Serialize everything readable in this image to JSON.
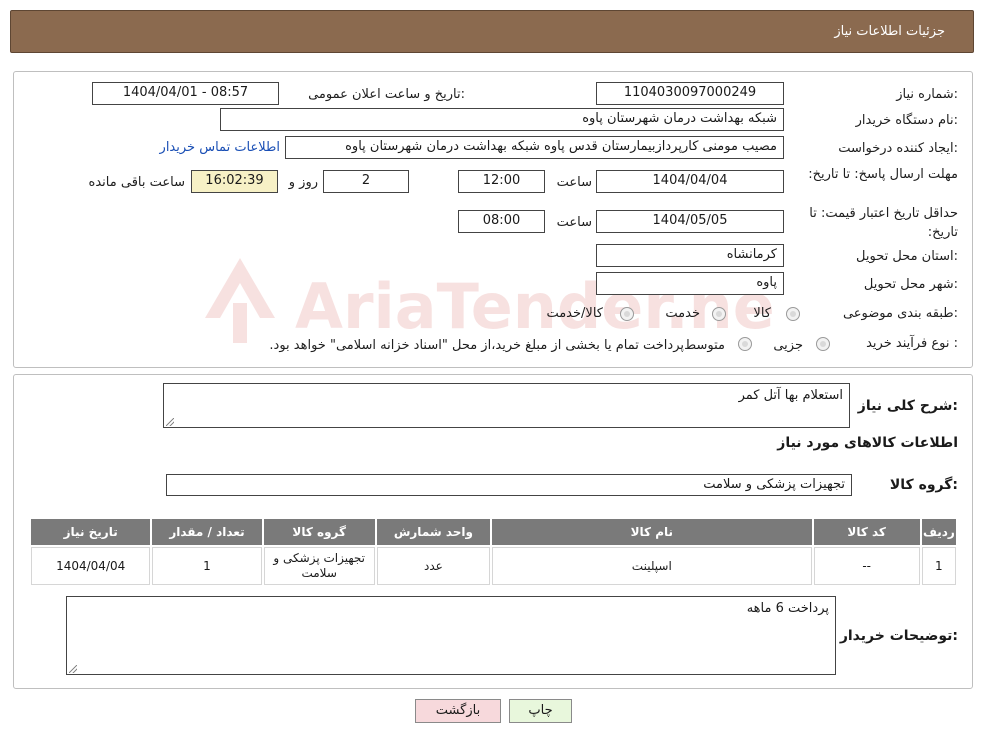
{
  "header": {
    "title": "جزئیات اطلاعات نیاز"
  },
  "watermark": {
    "text": "AriaTender.neT"
  },
  "form": {
    "need_number_label": "شماره نیاز:",
    "need_number": "1104030097000249",
    "announce_label": "تاریخ و ساعت اعلان عمومی:",
    "announce_value": "1404/04/01 - 08:57",
    "buyer_label": "نام دستگاه خریدار:",
    "buyer_value": "شبکه بهداشت درمان شهرستان پاوه",
    "creator_label": "ایجاد کننده درخواست:",
    "creator_value": "مصیب مومنی کارپردازبیمارستان قدس پاوه شبکه بهداشت درمان شهرستان پاوه",
    "contact_link": "اطلاعات تماس خریدار",
    "deadline_label": "مهلت ارسال پاسخ: تا تاریخ:",
    "deadline_date": "1404/04/04",
    "time_label": "ساعت",
    "deadline_time": "12:00",
    "days_value": "2",
    "days_label": "روز و",
    "remaining_time": "16:02:39",
    "remaining_label": "ساعت باقی مانده",
    "validity_label": "حداقل تاریخ اعتبار قیمت: تا تاریخ:",
    "validity_date": "1404/05/05",
    "validity_time_label": "ساعت",
    "validity_time": "08:00",
    "province_label": "استان محل تحویل:",
    "province_value": "کرمانشاه",
    "city_label": "شهر محل تحویل:",
    "city_value": "پاوه",
    "category_label": "طبقه بندی موضوعی:",
    "category_options": [
      "کالا",
      "خدمت",
      "کالا/خدمت"
    ],
    "process_label": "نوع فرآیند خرید :",
    "process_options": [
      "جزیی",
      "متوسط"
    ],
    "process_note": "پرداخت تمام یا بخشی از مبلغ خرید،از محل \"اسناد خزانه اسلامی\" خواهد بود."
  },
  "details": {
    "summary_label": "شرح کلی نیاز:",
    "summary_value": "استعلام بها آتل کمر",
    "goods_info_title": "اطلاعات کالاهای مورد نیاز",
    "group_label": "گروه کالا:",
    "group_value": "تجهیزات پزشکی و سلامت",
    "table": {
      "headers": [
        "ردیف",
        "کد کالا",
        "نام کالا",
        "واحد شمارش",
        "گروه کالا",
        "تعداد / مقدار",
        "تاریخ نیاز"
      ],
      "rows": [
        [
          "1",
          "--",
          "اسپلینت",
          "عدد",
          "تجهیزات پزشکی و سلامت",
          "1",
          "1404/04/04"
        ]
      ]
    },
    "buyer_notes_label": "توضیحات خریدار:",
    "buyer_notes_value": "پرداخت 6 ماهه"
  },
  "buttons": {
    "print": "چاپ",
    "back": "بازگشت"
  }
}
